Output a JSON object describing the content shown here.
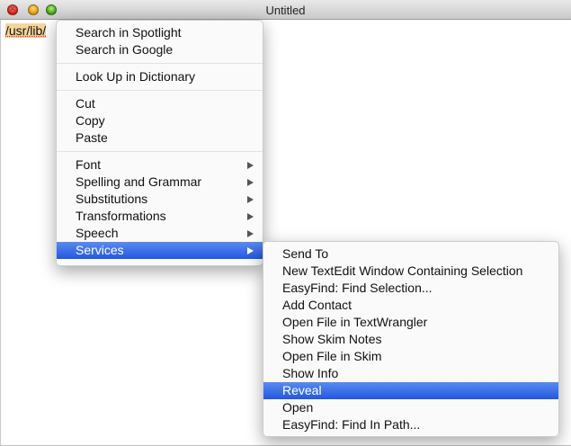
{
  "window": {
    "title": "Untitled"
  },
  "document": {
    "text": "/usr/lib/"
  },
  "context_menu": {
    "groups": [
      [
        "Search in Spotlight",
        "Search in Google"
      ],
      [
        "Look Up in Dictionary"
      ],
      [
        "Cut",
        "Copy",
        "Paste"
      ],
      [
        "Font",
        "Spelling and Grammar",
        "Substitutions",
        "Transformations",
        "Speech",
        "Services"
      ]
    ],
    "highlighted": "Services"
  },
  "services_menu": {
    "items": [
      "Send To",
      "New TextEdit Window Containing Selection",
      "EasyFind: Find Selection...",
      "Add Contact",
      "Open File in TextWrangler",
      "Show Skim Notes",
      "Open File in Skim",
      "Show Info",
      "Reveal",
      "Open",
      "EasyFind: Find In Path..."
    ],
    "highlighted": "Reveal"
  },
  "colors": {
    "highlight": "#3366e8",
    "selection": "#f5d59b"
  }
}
